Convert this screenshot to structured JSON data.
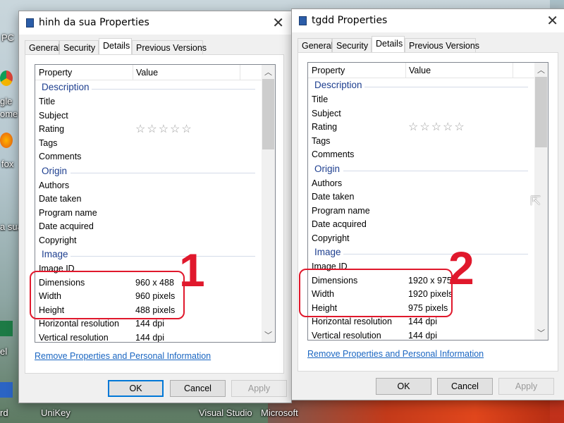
{
  "desktop": {
    "labels": [
      "PC",
      "gle",
      "ome",
      "fox",
      "a sua",
      "el",
      "rd",
      "UniKey",
      "Visual Studio",
      "Microsoft"
    ]
  },
  "windows": [
    {
      "title": "hinh da sua Properties",
      "tabs": [
        "General",
        "Security",
        "Details",
        "Previous Versions"
      ],
      "active_tab": 2,
      "columns": [
        "Property",
        "Value"
      ],
      "groups": {
        "description": "Description",
        "origin": "Origin",
        "image": "Image"
      },
      "rows": {
        "title": "Title",
        "subject": "Subject",
        "rating": "Rating",
        "tags": "Tags",
        "comments": "Comments",
        "authors": "Authors",
        "date_taken": "Date taken",
        "program_name": "Program name",
        "date_acquired": "Date acquired",
        "copyright": "Copyright",
        "image_id": "Image ID",
        "dimensions": "Dimensions",
        "width": "Width",
        "height": "Height",
        "hres": "Horizontal resolution",
        "vres": "Vertical resolution"
      },
      "values": {
        "rating": "☆☆☆☆☆",
        "dimensions": "960 x 488",
        "width": "960 pixels",
        "height": "488 pixels",
        "hres": "144 dpi",
        "vres": "144 dpi"
      },
      "link": "Remove Properties and Personal Information",
      "buttons": {
        "ok": "OK",
        "cancel": "Cancel",
        "apply": "Apply"
      },
      "annotation": "1"
    },
    {
      "title": "tgdd Properties",
      "tabs": [
        "General",
        "Security",
        "Details",
        "Previous Versions"
      ],
      "active_tab": 2,
      "columns": [
        "Property",
        "Value"
      ],
      "groups": {
        "description": "Description",
        "origin": "Origin",
        "image": "Image"
      },
      "rows": {
        "title": "Title",
        "subject": "Subject",
        "rating": "Rating",
        "tags": "Tags",
        "comments": "Comments",
        "authors": "Authors",
        "date_taken": "Date taken",
        "program_name": "Program name",
        "date_acquired": "Date acquired",
        "copyright": "Copyright",
        "image_id": "Image ID",
        "dimensions": "Dimensions",
        "width": "Width",
        "height": "Height",
        "hres": "Horizontal resolution",
        "vres": "Vertical resolution"
      },
      "values": {
        "rating": "☆☆☆☆☆",
        "dimensions": "1920 x 975",
        "width": "1920 pixels",
        "height": "975 pixels",
        "hres": "144 dpi",
        "vres": "144 dpi"
      },
      "link": "Remove Properties and Personal Information",
      "buttons": {
        "ok": "OK",
        "cancel": "Cancel",
        "apply": "Apply"
      },
      "annotation": "2"
    }
  ],
  "colors": {
    "annotation": "#e0182c",
    "link": "#1a66c2",
    "group": "#1e3f8f",
    "default_button": "#0078d7"
  }
}
